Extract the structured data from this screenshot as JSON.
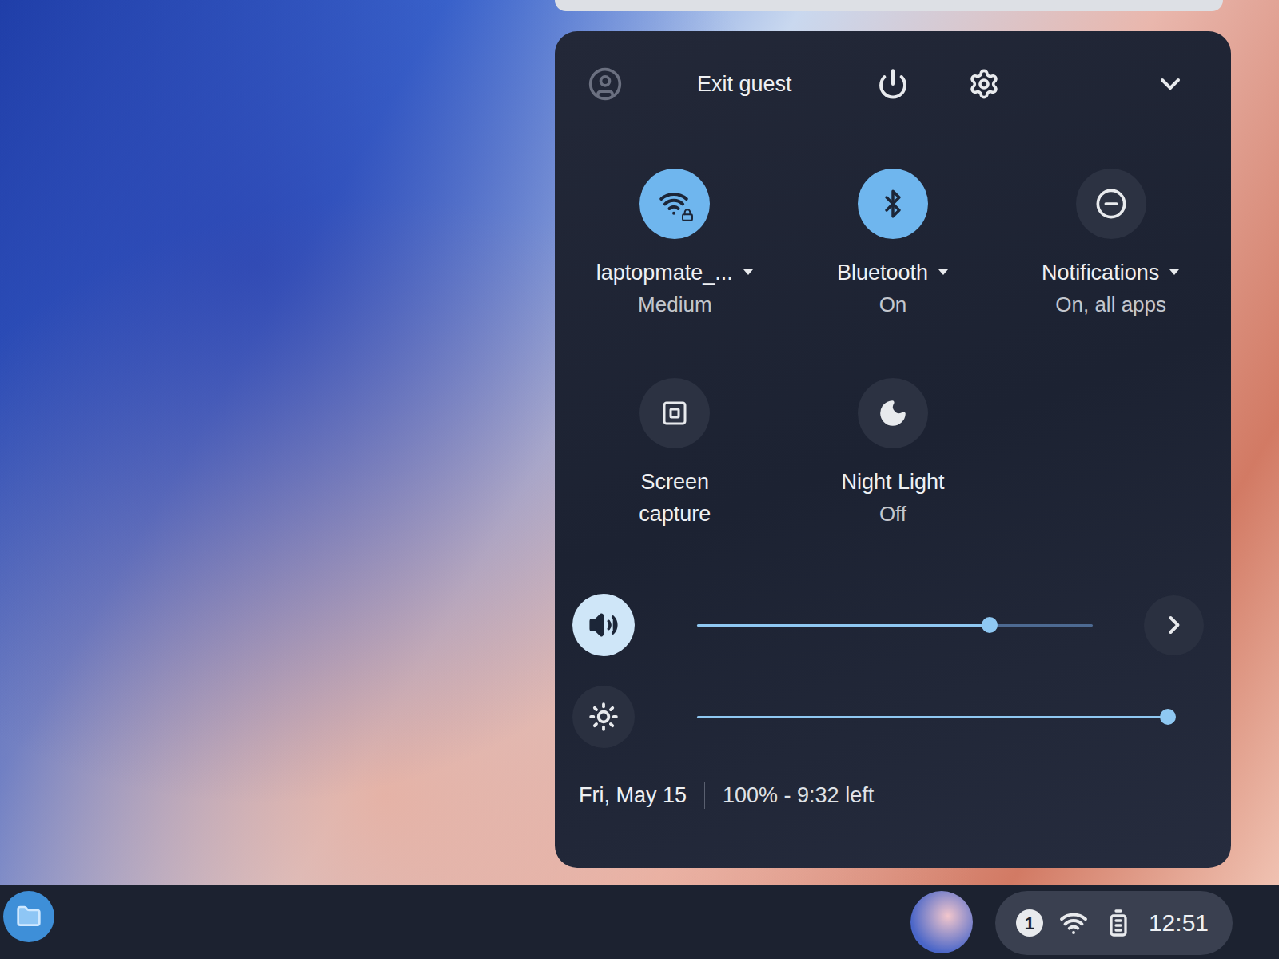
{
  "header": {
    "exit_label": "Exit guest"
  },
  "tiles": [
    {
      "kind": "network",
      "label": "laptopmate_...",
      "sublabel": "Medium",
      "on": true,
      "has_menu": true
    },
    {
      "kind": "bluetooth",
      "label": "Bluetooth",
      "sublabel": "On",
      "on": true,
      "has_menu": true
    },
    {
      "kind": "notifications",
      "label": "Notifications",
      "sublabel": "On, all apps",
      "on": false,
      "has_menu": true
    },
    {
      "kind": "capture",
      "label": "Screen capture",
      "sublabel": "",
      "on": false,
      "has_menu": false
    },
    {
      "kind": "night-light",
      "label": "Night Light",
      "sublabel": "Off",
      "on": false,
      "has_menu": false
    }
  ],
  "sliders": [
    {
      "kind": "volume",
      "level": 0.74,
      "active": true,
      "has_detail": true
    },
    {
      "kind": "brightness",
      "level": 1.0,
      "active": false,
      "has_detail": false
    }
  ],
  "footer": {
    "date": "Fri, May 15",
    "battery": "100% - 9:32 left"
  },
  "shelf": {
    "notification_count": "1",
    "time": "12:51"
  }
}
